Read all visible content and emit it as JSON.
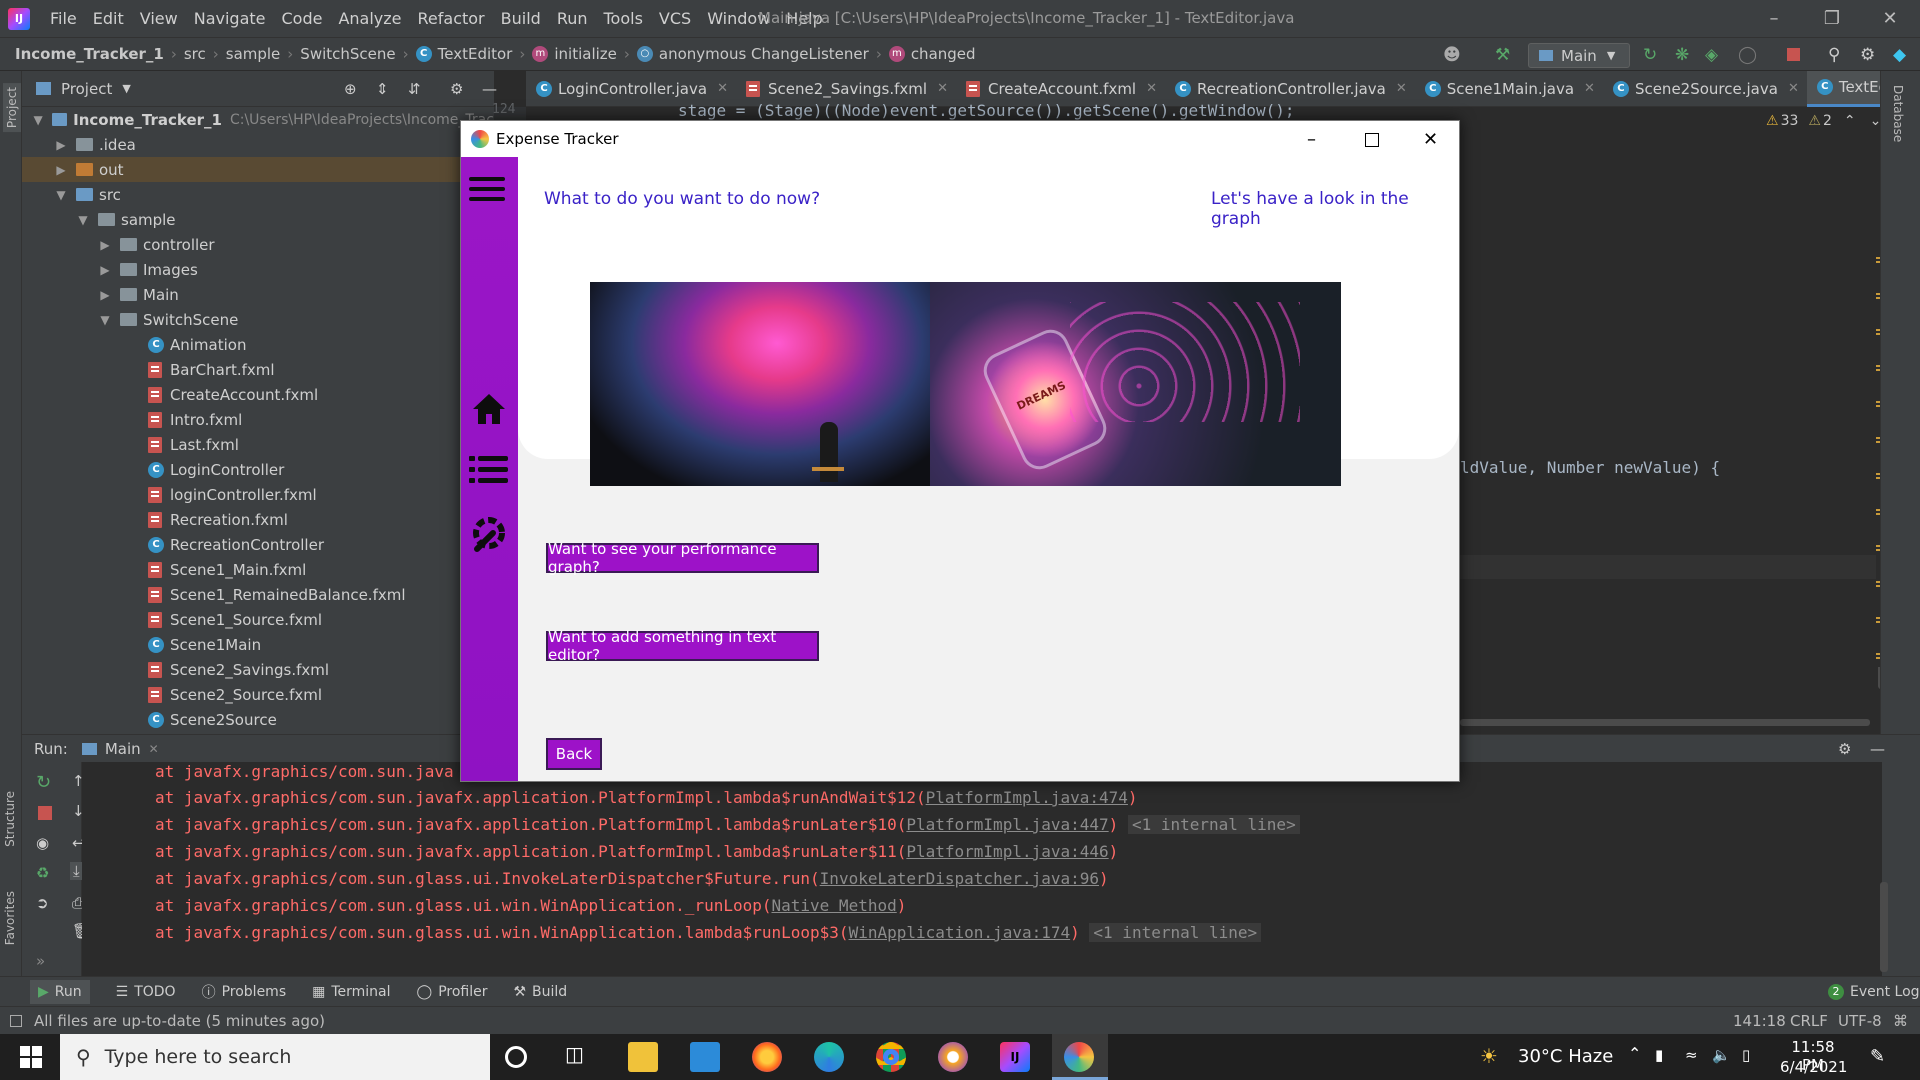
{
  "ide": {
    "menu": [
      "File",
      "Edit",
      "View",
      "Navigate",
      "Code",
      "Analyze",
      "Refactor",
      "Build",
      "Run",
      "Tools",
      "VCS",
      "Window",
      "Help"
    ],
    "window_title": "Main.java [C:\\Users\\HP\\IdeaProjects\\Income_Tracker_1] - TextEditor.java",
    "breadcrumbs": {
      "project": "Income_Tracker_1",
      "src": "src",
      "sample": "sample",
      "switchscene": "SwitchScene",
      "texteditor": "TextEditor",
      "initialize": "initialize",
      "listener": "anonymous ChangeListener",
      "changed": "changed"
    },
    "run_config": "Main",
    "project_panel": {
      "title": "Project",
      "root_name": "Income_Tracker_1",
      "root_path": "C:\\Users\\HP\\IdeaProjects\\Income_Tracker_1",
      "items": {
        "idea": ".idea",
        "out": "out",
        "src": "src",
        "sample": "sample",
        "controller": "controller",
        "images": "Images",
        "main": "Main",
        "switchscene": "SwitchScene",
        "animation": "Animation",
        "barchart": "BarChart.fxml",
        "createaccount": "CreateAccount.fxml",
        "intro": "Intro.fxml",
        "last": "Last.fxml",
        "logincontroller": "LoginController",
        "logincontrollerfxml": "loginController.fxml",
        "recreation": "Recreation.fxml",
        "recreationcontroller": "RecreationController",
        "scene1main": "Scene1_Main.fxml",
        "scene1remained": "Scene1_RemainedBalance.fxml",
        "scene1source": "Scene1_Source.fxml",
        "scene1mainclass": "Scene1Main",
        "scene2savings": "Scene2_Savings.fxml",
        "scene2source": "Scene2_Source.fxml",
        "scene2sourceclass": "Scene2Source"
      }
    },
    "editor_tabs": {
      "t1": "LoginController.java",
      "t2": "Scene2_Savings.fxml",
      "t3": "CreateAccount.fxml",
      "t4": "RecreationController.java",
      "t5": "Scene1Main.java",
      "t6": "Scene2Source.java",
      "t7": "TextEditor.java"
    },
    "editor": {
      "line_no": "124",
      "line1": "stage = (Stage)((Node)event.getSource()).getScene().getWindow();",
      "line2": "ldValue, Number newValue) {",
      "warnings": "33",
      "weak_warnings": "2"
    },
    "run_panel": {
      "label": "Run:",
      "tab": "Main",
      "lines": {
        "l0": "at javafx.graphics/com.sun.java",
        "l1_pre": "at javafx.graphics/com.sun.javafx.application.PlatformImpl.lambda$runAndWait$12(",
        "l1_link": "PlatformImpl.java:474",
        "l2_pre": "at javafx.graphics/com.sun.javafx.application.PlatformImpl.lambda$runLater$10(",
        "l2_link": "PlatformImpl.java:447",
        "l3_pre": "at javafx.graphics/com.sun.javafx.application.PlatformImpl.lambda$runLater$11(",
        "l3_link": "PlatformImpl.java:446",
        "l4_pre": "at javafx.graphics/com.sun.glass.ui.InvokeLaterDispatcher$Future.run(",
        "l4_link": "InvokeLaterDispatcher.java:96",
        "l5_pre": "at javafx.graphics/com.sun.glass.ui.win.WinApplication._runLoop(",
        "l5_link": "Native Method",
        "l6_pre": "at javafx.graphics/com.sun.glass.ui.win.WinApplication.lambda$runLoop$3(",
        "l6_link": "WinApplication.java:174",
        "close_paren": ")",
        "internal": "<1 internal line>"
      }
    },
    "bottom_tools": {
      "run": "Run",
      "todo": "TODO",
      "problems": "Problems",
      "terminal": "Terminal",
      "profiler": "Profiler",
      "build": "Build",
      "event_log": "Event Log",
      "event_count": "2"
    },
    "status": {
      "message": "All files are up-to-date (5 minutes ago)",
      "position": "141:18",
      "line_sep": "CRLF",
      "encoding": "UTF-8"
    },
    "side_labels": {
      "project": "Project",
      "structure": "Structure",
      "favorites": "Favorites",
      "database": "Database"
    }
  },
  "app": {
    "title": "Expense Tracker",
    "question": "What to do you want to do now?",
    "graph_prompt": "Let's have a look in the graph",
    "btn_graph": "Want to see your performance graph?",
    "btn_text_editor": "Want to add something in text editor?",
    "btn_back": "Back",
    "banner_label": "DREAMS"
  },
  "taskbar": {
    "search_placeholder": "Type here to search",
    "weather": "30°C  Haze",
    "time": "11:58 PM",
    "date": "6/4/2021"
  },
  "colors": {
    "app_purple": "#9d12c8",
    "app_label": "#3a22c7",
    "ide_bg": "#2b2b2b",
    "error_text": "#ff6b68"
  }
}
